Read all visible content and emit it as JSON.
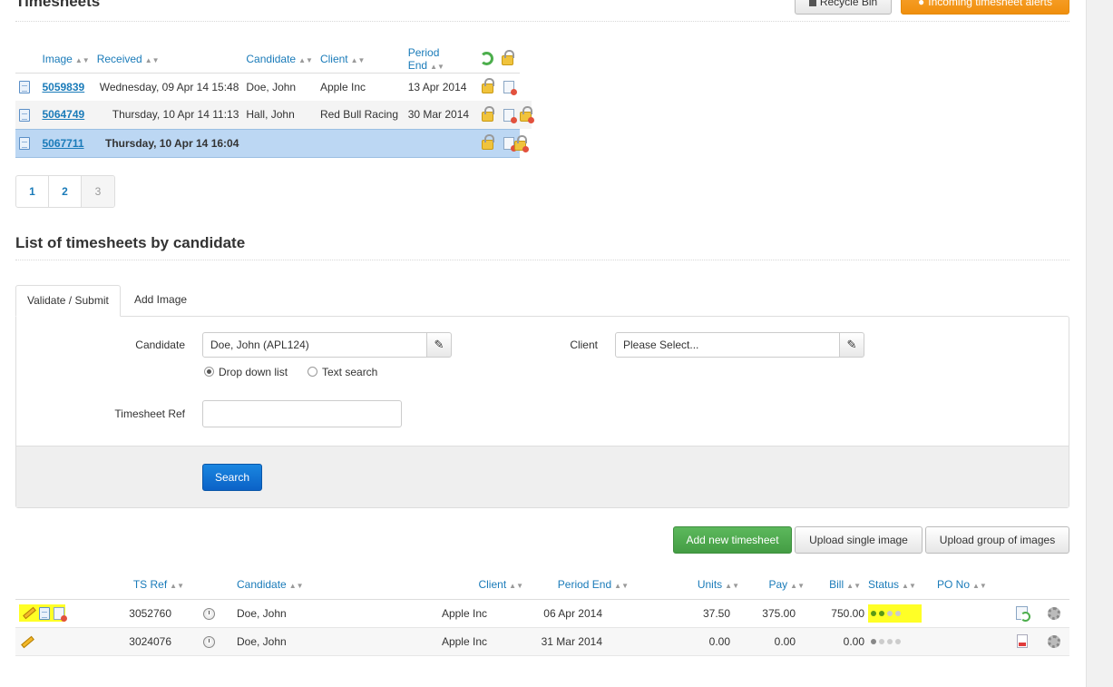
{
  "page": {
    "title": "Timesheets",
    "recycle_bin": "Recycle Bin",
    "incoming_alerts": "Incoming timesheet alerts"
  },
  "images_table": {
    "headers": {
      "image": "Image",
      "received": "Received",
      "candidate": "Candidate",
      "client": "Client",
      "period_end": "Period End"
    },
    "rows": [
      {
        "id": "5059839",
        "received": "Wednesday, 09 Apr 14 15:48",
        "candidate": "Doe, John",
        "client": "Apple Inc",
        "period_end": "13 Apr 2014"
      },
      {
        "id": "5064749",
        "received": "Thursday, 10 Apr 14 11:13",
        "candidate": "Hall, John",
        "client": "Red Bull Racing",
        "period_end": "30 Mar 2014"
      },
      {
        "id": "5067711",
        "received": "Thursday, 10 Apr 14 16:04",
        "candidate": "",
        "client": "",
        "period_end": ""
      }
    ]
  },
  "pagination": {
    "pages": [
      "1",
      "2",
      "3"
    ],
    "current": "3"
  },
  "list_section": {
    "title": "List of timesheets by candidate",
    "tabs": [
      "Validate / Submit",
      "Add Image"
    ],
    "candidate_label": "Candidate",
    "candidate_value": "Doe, John (APL124)",
    "client_label": "Client",
    "client_value": "Please Select...",
    "radio_dropdown": "Drop down list",
    "radio_text": "Text search",
    "ts_ref_label": "Timesheet Ref",
    "ts_ref_value": "",
    "search_button": "Search"
  },
  "actions": {
    "add_new": "Add new timesheet",
    "upload_single": "Upload single image",
    "upload_group": "Upload group of images"
  },
  "timesheets_table": {
    "headers": {
      "ts_ref": "TS Ref",
      "candidate": "Candidate",
      "client": "Client",
      "period_end": "Period End",
      "units": "Units",
      "pay": "Pay",
      "bill": "Bill",
      "status": "Status",
      "po_no": "PO No"
    },
    "rows": [
      {
        "ts_ref": "3052760",
        "candidate": "Doe, John",
        "client": "Apple Inc",
        "period_end": "06 Apr 2014",
        "units": "37.50",
        "pay": "375.00",
        "bill": "750.00",
        "status_progress": 2
      },
      {
        "ts_ref": "3024076",
        "candidate": "Doe, John",
        "client": "Apple Inc",
        "period_end": "31 Mar 2014",
        "units": "0.00",
        "pay": "0.00",
        "bill": "0.00",
        "status_progress": 1
      }
    ]
  },
  "colors": {
    "link": "#1a7bb9",
    "selected_row": "#bcd7f3",
    "highlight": "#ffff26",
    "green_button": "#5cb85c",
    "orange_button": "#f08f0d",
    "blue_button": "#0b62c7"
  }
}
